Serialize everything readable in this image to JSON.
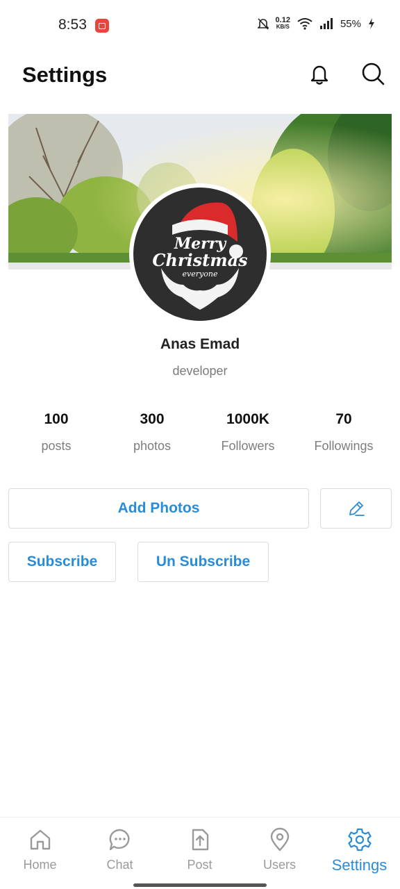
{
  "status_bar": {
    "time": "8:53",
    "net_speed": "0.12",
    "net_unit": "KB/S",
    "battery": "55%",
    "icons": [
      "screen-record-icon",
      "mute-icon",
      "wifi-icon",
      "signal-icon",
      "charging-icon"
    ]
  },
  "header": {
    "title": "Settings",
    "icons": [
      "bell-icon",
      "search-icon"
    ]
  },
  "profile": {
    "avatar_text_1": "Merry",
    "avatar_text_2": "Christmas",
    "avatar_text_3": "everyone",
    "name": "Anas Emad",
    "role": "developer"
  },
  "stats": [
    {
      "value": "100",
      "label": "posts"
    },
    {
      "value": "300",
      "label": "photos"
    },
    {
      "value": "1000K",
      "label": "Followers"
    },
    {
      "value": "70",
      "label": "Followings"
    }
  ],
  "actions": {
    "add_photos": "Add Photos",
    "edit_icon": "pencil-icon",
    "subscribe": "Subscribe",
    "unsubscribe": "Un Subscribe"
  },
  "bottom_nav": {
    "items": [
      {
        "label": "Home",
        "icon": "home-icon"
      },
      {
        "label": "Chat",
        "icon": "chat-icon"
      },
      {
        "label": "Post",
        "icon": "upload-icon"
      },
      {
        "label": "Users",
        "icon": "location-icon"
      },
      {
        "label": "Settings",
        "icon": "gear-icon",
        "active": true
      }
    ]
  },
  "colors": {
    "accent": "#2a8bd6",
    "muted": "#7d7d7d",
    "border": "#dcdcdc"
  }
}
